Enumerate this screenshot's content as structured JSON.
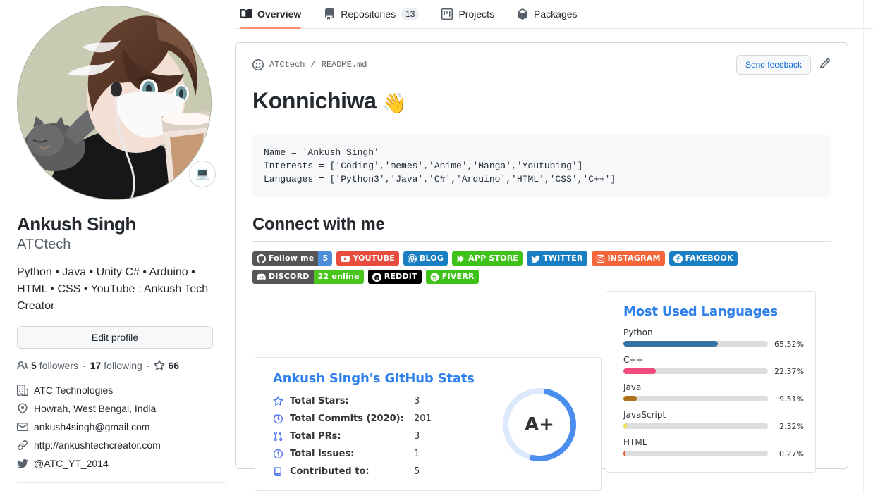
{
  "tabs": [
    {
      "label": "Overview",
      "icon": "book-icon",
      "selected": true,
      "count": null
    },
    {
      "label": "Repositories",
      "icon": "repo-icon",
      "selected": false,
      "count": "13"
    },
    {
      "label": "Projects",
      "icon": "project-icon",
      "selected": false,
      "count": null
    },
    {
      "label": "Packages",
      "icon": "package-icon",
      "selected": false,
      "count": null
    }
  ],
  "profile": {
    "avatar_alt": "anime-avatar",
    "status_emoji": "💻",
    "fullname": "Ankush Singh",
    "username": "ATCtech",
    "bio": "Python • Java • Unity C# • Arduino • HTML • CSS • YouTube : Ankush Tech Creator",
    "edit_button": "Edit profile",
    "followers_count": "5",
    "followers_label": "followers",
    "following_count": "17",
    "following_label": "following",
    "stars_count": "66",
    "details": [
      {
        "icon": "organization-icon",
        "text": "ATC Technologies"
      },
      {
        "icon": "location-icon",
        "text": "Howrah, West Bengal, India"
      },
      {
        "icon": "mail-icon",
        "text": "ankush4singh@gmail.com"
      },
      {
        "icon": "link-icon",
        "text": "http://ankushtechcreator.com"
      },
      {
        "icon": "twitter-icon",
        "text": "@ATC_YT_2014"
      }
    ]
  },
  "readme": {
    "owner": "ATCtech",
    "separator": "/",
    "filename": "README.md",
    "smiley_icon": "smiley-icon",
    "send_feedback": "Send feedback",
    "pencil_icon": "pencil-icon",
    "heading": "Konnichiwa",
    "heading_emoji": "👋",
    "code": "Name = 'Ankush Singh'\nInterests = ['Coding','memes','Anime','Manga','Youtubing']\nLanguages = ['Python3','Java','C#','Arduino','HTML','CSS','C++']",
    "connect_heading": "Connect with me"
  },
  "badges": [
    {
      "name": "follow-me",
      "icon": "github-icon",
      "label": "Follow me",
      "label_bg": "#555555",
      "count": "5",
      "count_bg": "#4c8eda",
      "icon_color": "#ffffff"
    },
    {
      "name": "youtube",
      "icon": "youtube-icon",
      "label": "YOUTUBE",
      "label_bg": "#e74c3c",
      "count": null,
      "count_bg": null,
      "icon_color": "#ffffff"
    },
    {
      "name": "blog",
      "icon": "wordpress-icon",
      "label": "BLOG",
      "label_bg": "#1a7ec2",
      "count": null,
      "count_bg": null,
      "icon_color": "#ffffff"
    },
    {
      "name": "app-store",
      "icon": "play-icon",
      "label": "APP STORE",
      "label_bg": "#3ec21a",
      "count": null,
      "count_bg": null,
      "icon_color": "#ffffff"
    },
    {
      "name": "twitter",
      "icon": "twitter-icon",
      "label": "TWITTER",
      "label_bg": "#1a7ec2",
      "count": null,
      "count_bg": null,
      "icon_color": "#ffffff"
    },
    {
      "name": "instagram",
      "icon": "instagram-icon",
      "label": "INSTAGRAM",
      "label_bg": "#f4663a",
      "count": null,
      "count_bg": null,
      "icon_color": "#ffffff"
    },
    {
      "name": "fakebook",
      "icon": "facebook-icon",
      "label": "FAKEBOOK",
      "label_bg": "#1a7ec2",
      "count": null,
      "count_bg": null,
      "icon_color": "#ffffff"
    },
    {
      "name": "discord",
      "icon": "discord-icon",
      "label": "DISCORD",
      "label_bg": "#555555",
      "count": "22 online",
      "count_bg": "#4ac51c",
      "icon_color": "#ffffff"
    },
    {
      "name": "reddit",
      "icon": "reddit-icon",
      "label": "REDDIT",
      "label_bg": "#000000",
      "count": null,
      "count_bg": null,
      "icon_color": "#ffffff"
    },
    {
      "name": "fiverr",
      "icon": "fiverr-icon",
      "label": "FIVERR",
      "label_bg": "#3ec21a",
      "count": null,
      "count_bg": null,
      "icon_color": "#ffffff"
    }
  ],
  "chart_data": [
    {
      "type": "table",
      "name": "github-stats",
      "title": "Ankush Singh's GitHub Stats",
      "title_color": "#2f80ed",
      "categories": [
        "Total Stars:",
        "Total Commits (2020):",
        "Total PRs:",
        "Total Issues:",
        "Contributed to:"
      ],
      "values": [
        3,
        201,
        3,
        1,
        5
      ],
      "icons": [
        "star-icon",
        "clock-icon",
        "pull-request-icon",
        "issue-icon",
        "repo-icon"
      ],
      "rank": "A+",
      "rank_progress_pct": 50,
      "ring_color": "#4c8eee",
      "ring_track_color": "#dce8fb"
    },
    {
      "type": "bar",
      "name": "most-used-languages",
      "title": "Most Used Languages",
      "title_color": "#2f80ed",
      "categories": [
        "Python",
        "C++",
        "Java",
        "JavaScript",
        "HTML"
      ],
      "values": [
        65.52,
        22.37,
        9.51,
        2.32,
        0.27
      ],
      "labels": [
        "65.52%",
        "22.37%",
        "9.51%",
        "2.32%",
        "0.27%"
      ],
      "colors": [
        "#3572A5",
        "#f34b7d",
        "#b07219",
        "#f1e05a",
        "#e34c26"
      ],
      "xlabel": "",
      "ylabel": "",
      "xlim": [
        0,
        100
      ],
      "grid": false,
      "legend": "none",
      "orientation": "horizontal"
    }
  ]
}
